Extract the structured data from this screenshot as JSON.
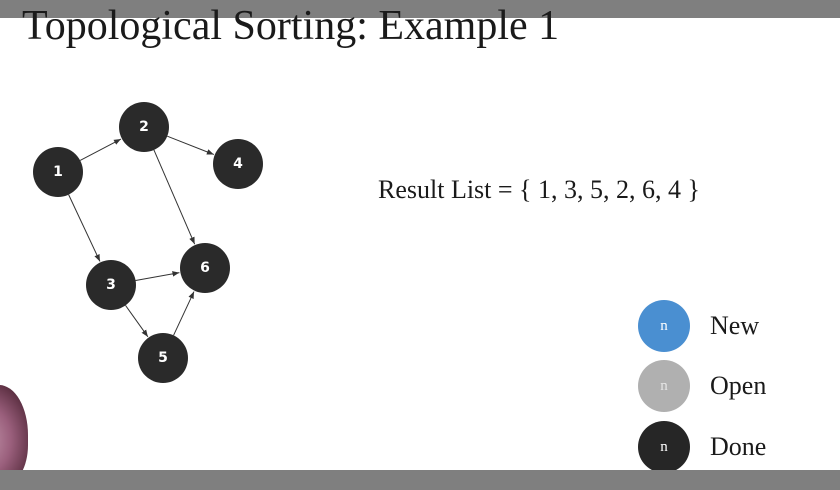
{
  "slide": {
    "title": "Topological Sorting: Example 1",
    "result_text": "Result List = { 1, 3, 5, 2, 6, 4 }"
  },
  "graph": {
    "node_color": "#2a2a2a",
    "edge_color": "#333333",
    "nodes": [
      {
        "id": "1",
        "label": "1"
      },
      {
        "id": "2",
        "label": "2"
      },
      {
        "id": "3",
        "label": "3"
      },
      {
        "id": "4",
        "label": "4"
      },
      {
        "id": "5",
        "label": "5"
      },
      {
        "id": "6",
        "label": "6"
      }
    ],
    "edges": [
      {
        "from": "1",
        "to": "2"
      },
      {
        "from": "1",
        "to": "3"
      },
      {
        "from": "2",
        "to": "4"
      },
      {
        "from": "2",
        "to": "6"
      },
      {
        "from": "3",
        "to": "6"
      },
      {
        "from": "3",
        "to": "5"
      },
      {
        "from": "5",
        "to": "6"
      }
    ]
  },
  "legend": {
    "items": [
      {
        "symbol": "n",
        "label": "New",
        "color": "#4a8fd1"
      },
      {
        "symbol": "n",
        "label": "Open",
        "color": "#b0b0b0"
      },
      {
        "symbol": "n",
        "label": "Done",
        "color": "#262626"
      }
    ]
  }
}
